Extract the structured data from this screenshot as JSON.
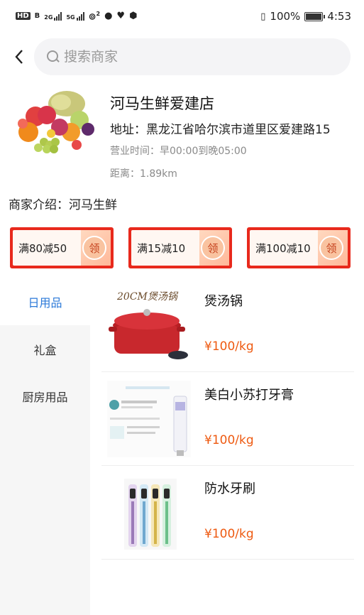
{
  "status_bar": {
    "left_badges": [
      "HD",
      "B",
      "2G",
      "5G"
    ],
    "superscript": "2",
    "battery_text": "100%",
    "time": "4:53",
    "icons": [
      "hd-icon",
      "signal-icon",
      "wifi-icon",
      "notification-icon",
      "heart-icon",
      "shield-icon",
      "vibrate-icon",
      "battery-icon"
    ],
    "battery_level": 1.0
  },
  "search": {
    "placeholder": "搜索商家"
  },
  "store": {
    "name": "河马生鲜爱建店",
    "address": "地址：黑龙江省哈尔滨市道里区爱建路15",
    "hours": "营业时间：早00:00到晚05:00",
    "distance": "距离：1.89km",
    "intro": "商家介绍：河马生鲜"
  },
  "coupons": [
    {
      "label": "满80减50",
      "action": "领"
    },
    {
      "label": "满15减10",
      "action": "领"
    },
    {
      "label": "满100减10",
      "action": "领"
    }
  ],
  "categories": [
    {
      "label": "日用品",
      "active": true
    },
    {
      "label": "礼盒",
      "active": false
    },
    {
      "label": "厨房用品",
      "active": false
    }
  ],
  "products": [
    {
      "name": "煲汤锅",
      "price": "¥100/kg",
      "image_caption": "20CM煲汤锅"
    },
    {
      "name": "美白小苏打牙膏",
      "price": "¥100/kg",
      "image_caption": ""
    },
    {
      "name": "防水牙刷",
      "price": "¥100/kg",
      "image_caption": ""
    }
  ],
  "colors": {
    "accent_blue": "#2a78d8",
    "price_orange": "#ee5a11",
    "coupon_red": "#e8291c",
    "sidebar_bg": "#f6f6f6"
  }
}
